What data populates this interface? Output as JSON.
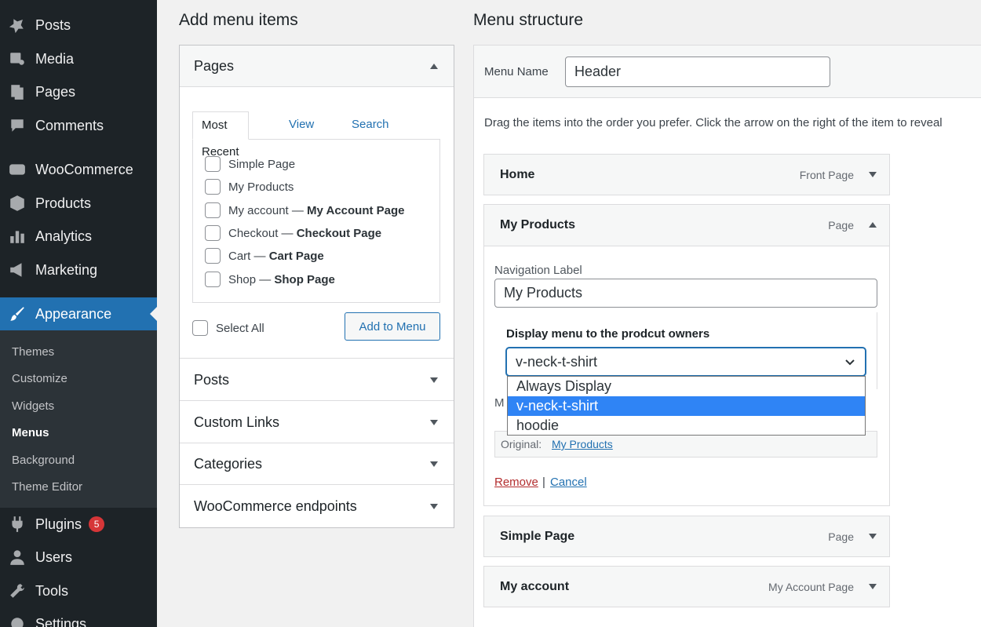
{
  "sidebar": {
    "items": [
      {
        "label": "Posts",
        "icon": "pin-icon"
      },
      {
        "label": "Media",
        "icon": "media-icon"
      },
      {
        "label": "Pages",
        "icon": "pages-icon"
      },
      {
        "label": "Comments",
        "icon": "comments-icon"
      },
      {
        "label": "WooCommerce",
        "icon": "woocommerce-icon"
      },
      {
        "label": "Products",
        "icon": "products-icon"
      },
      {
        "label": "Analytics",
        "icon": "analytics-icon"
      },
      {
        "label": "Marketing",
        "icon": "megaphone-icon"
      },
      {
        "label": "Appearance",
        "icon": "brush-icon"
      },
      {
        "label": "Plugins",
        "icon": "plugin-icon",
        "badge": "5"
      },
      {
        "label": "Users",
        "icon": "users-icon"
      },
      {
        "label": "Tools",
        "icon": "tools-icon"
      },
      {
        "label": "Settings",
        "icon": "settings-icon"
      }
    ],
    "submenu": [
      "Themes",
      "Customize",
      "Widgets",
      "Menus",
      "Background",
      "Theme Editor"
    ],
    "active_sub": "Menus"
  },
  "add_items": {
    "heading": "Add menu items",
    "pages": {
      "title": "Pages",
      "tabs": [
        "Most Recent",
        "View All",
        "Search"
      ],
      "items": [
        {
          "name": "Simple Page",
          "suffix": ""
        },
        {
          "name": "My Products",
          "suffix": ""
        },
        {
          "name": "My account — ",
          "suffix": "My Account Page"
        },
        {
          "name": "Checkout — ",
          "suffix": "Checkout Page"
        },
        {
          "name": "Cart — ",
          "suffix": "Cart Page"
        },
        {
          "name": "Shop — ",
          "suffix": "Shop Page"
        }
      ],
      "select_all": "Select All",
      "add_button": "Add to Menu"
    },
    "sections": [
      "Posts",
      "Custom Links",
      "Categories",
      "WooCommerce endpoints"
    ]
  },
  "structure": {
    "heading": "Menu structure",
    "menu_name_label": "Menu Name",
    "menu_name_value": "Header",
    "instructions": "Drag the items into the order you prefer. Click the arrow on the right of the item to reveal",
    "items": [
      {
        "title": "Home",
        "type": "Front Page"
      },
      {
        "title": "My Products",
        "type": "Page"
      },
      {
        "title": "Simple Page",
        "type": "Page"
      },
      {
        "title": "My account",
        "type": "My Account Page"
      }
    ],
    "expanded": {
      "nav_label_label": "Navigation Label",
      "nav_label_value": "My Products",
      "display_label": "Display menu to the prodcut owners",
      "select_value": "v-neck-t-shirt",
      "options": [
        "Always Display",
        "v-neck-t-shirt",
        "hoodie"
      ],
      "selected_option": "v-neck-t-shirt",
      "hidden_letter": "M",
      "original_label": "Original:",
      "original_link": "My Products",
      "remove": "Remove",
      "separator": "|",
      "cancel": "Cancel"
    }
  }
}
